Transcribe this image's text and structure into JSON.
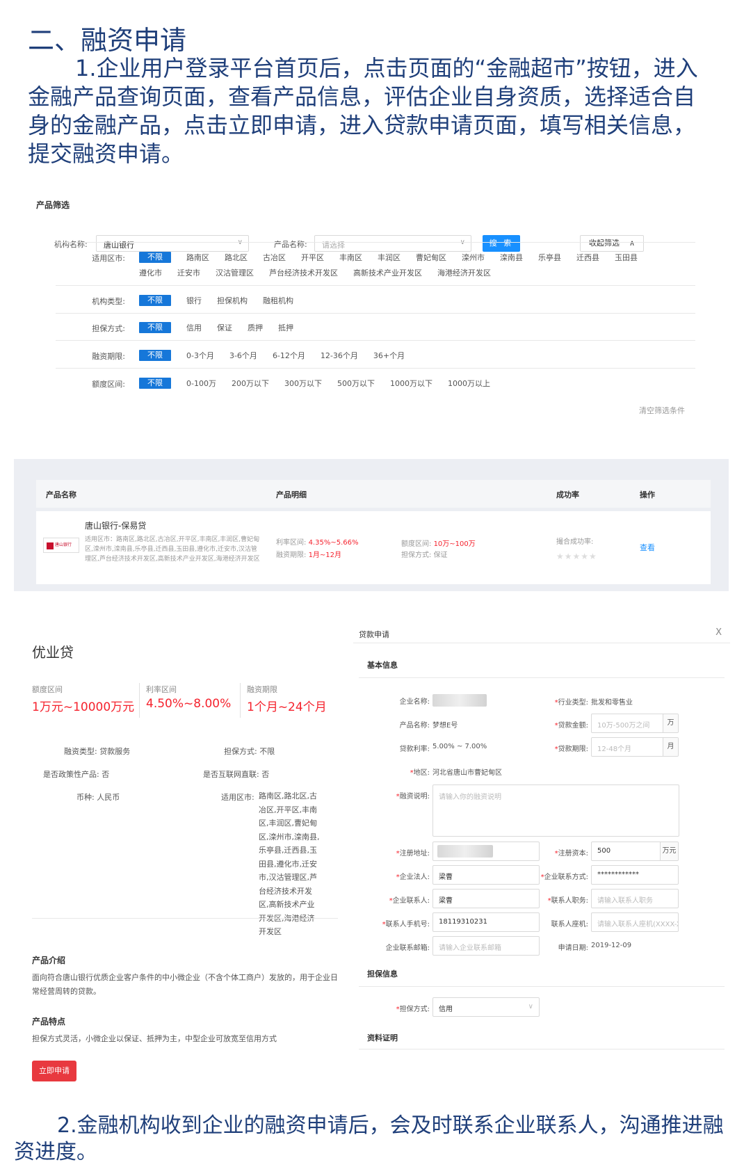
{
  "heading": "二、融资申请",
  "step1": "1.企业用户登录平台首页后，点击页面的“金融超市”按钮，进入金融产品查询页面，查看产品信息，评估企业自身资质，选择适合自身的金融产品，点击立即申请，进入贷款申请页面，填写相关信息，提交融资申请。",
  "filter": {
    "title": "产品筛选",
    "institution_label": "机构名称:",
    "institution_value": "唐山银行",
    "product_label": "产品名称:",
    "product_placeholder": "请选择",
    "search_label": "搜 索",
    "collapse_label": "收起筛选",
    "clear_label": "清空筛选条件",
    "rows": [
      {
        "label": "适用区市:",
        "options": [
          "不限",
          "路南区",
          "路北区",
          "古冶区",
          "开平区",
          "丰南区",
          "丰润区",
          "曹妃甸区",
          "滦州市",
          "滦南县",
          "乐亭县",
          "迁西县",
          "玉田县",
          "遵化市",
          "迁安市",
          "汉沽管理区",
          "芦台经济技术开发区",
          "高新技术产业开发区",
          "海港经济开发区"
        ]
      },
      {
        "label": "机构类型:",
        "options": [
          "不限",
          "银行",
          "担保机构",
          "融租机构"
        ]
      },
      {
        "label": "担保方式:",
        "options": [
          "不限",
          "信用",
          "保证",
          "质押",
          "抵押"
        ]
      },
      {
        "label": "融资期限:",
        "options": [
          "不限",
          "0-3个月",
          "3-6个月",
          "6-12个月",
          "12-36个月",
          "36+个月"
        ]
      },
      {
        "label": "额度区间:",
        "options": [
          "不限",
          "0-100万",
          "200万以下",
          "300万以下",
          "500万以下",
          "1000万以下",
          "1000万以上"
        ]
      }
    ]
  },
  "table": {
    "headers": [
      "产品名称",
      "产品明细",
      "成功率",
      "操作"
    ],
    "row": {
      "logo_text": "唐山银行",
      "name": "唐山银行-保易贷",
      "cities": "适用区市：路南区,路北区,古冶区,开平区,丰南区,丰润区,曹妃甸区,滦州市,滦南县,乐亭县,迁西县,玉田县,遵化市,迁安市,汉沽管理区,芦台经济技术开发区,高新技术产业开发区,海港经济开发区",
      "rate_label": "利率区间:",
      "rate_value": "4.35%~5.66%",
      "term_label": "融资期限:",
      "term_value": "1月~12月",
      "amount_label": "额度区间:",
      "amount_value": "10万~100万",
      "guarantee_label": "担保方式:",
      "guarantee_value": "保证",
      "success_label": "撮合成功率:",
      "stars": "★★★★★",
      "action": "查看"
    }
  },
  "detail": {
    "title": "优业贷",
    "amount_label": "额度区间",
    "amount_value": "1万元~10000万元",
    "rate_label": "利率区间",
    "rate_value": "4.50%~8.00%",
    "term_label": "融资期限",
    "term_value": "1个月~24个月",
    "type_kv": "融资类型: 贷款服务",
    "guarantee_kv": "担保方式: 不限",
    "policy_kv": "是否政策性产品: 否",
    "internet_kv": "是否互联网直联: 否",
    "currency_kv": "币种: 人民币",
    "city_label": "适用区市:",
    "city_value": "路南区,路北区,古冶区,开平区,丰南区,丰润区,曹妃甸区,滦州市,滦南县,乐亭县,迁西县,玉田县,遵化市,迁安市,汉沽管理区,芦台经济技术开发区,高新技术产业开发区,海港经济开发区",
    "intro_title": "产品介绍",
    "intro_text": "面向符合唐山银行优质企业客户条件的中小微企业（不含个体工商户）发放的，用于企业日常经营周转的贷款。",
    "feature_title": "产品特点",
    "feature_text": "担保方式灵活，小微企业以保证、抵押为主，中型企业可放宽至信用方式",
    "apply_label": "立即申请"
  },
  "loan": {
    "title": "贷款申请",
    "close": "X",
    "basic_section": "基本信息",
    "company_label": "企业名称:",
    "industry_label": "行业类型:",
    "industry_value": "批发和零售业",
    "product_label": "产品名称:",
    "product_value": "梦想E号",
    "amount_label": "贷款金额:",
    "amount_placeholder": "10万-500万之间",
    "amount_unit": "万",
    "rate_label": "贷款利率:",
    "rate_value": "5.00% ~ 7.00%",
    "term_label": "贷款期限:",
    "term_placeholder": "12-48个月",
    "term_unit": "月",
    "region_label": "地区:",
    "region_value": "河北省唐山市曹妃甸区",
    "desc_label": "融资说明:",
    "desc_placeholder": "请输入你的融资说明",
    "reg_addr_label": "注册地址:",
    "reg_cap_label": "注册资本:",
    "reg_cap_value": "500",
    "reg_cap_unit": "万元",
    "legal_label": "企业法人:",
    "legal_value": "梁曹",
    "contact_way_label": "企业联系方式:",
    "contact_way_value": "************",
    "contact_label": "企业联系人:",
    "contact_value": "梁曹",
    "position_label": "联系人职务:",
    "position_placeholder": "请输入联系人职务",
    "phone_label": "联系人手机号:",
    "phone_value": "18119310231",
    "landline_label": "联系人座机:",
    "landline_placeholder": "请输入联系人座机(XXXX-XXXXXXXX)",
    "email_label": "企业联系邮箱:",
    "email_placeholder": "请输入企业联系邮箱",
    "date_label": "申请日期:",
    "date_value": "2019-12-09",
    "guarantee_section": "担保信息",
    "guarantee_label": "担保方式:",
    "guarantee_value": "信用",
    "proof_section": "资料证明"
  },
  "step2": "2.金融机构收到企业的融资申请后，会及时联系企业联系人，沟通推进融资进度。",
  "colors": {
    "heading": "#1f3f7a",
    "accent": "#1890ff",
    "active_tag": "#1677d9",
    "red": "#f5222d",
    "apply": "#e8393f"
  }
}
